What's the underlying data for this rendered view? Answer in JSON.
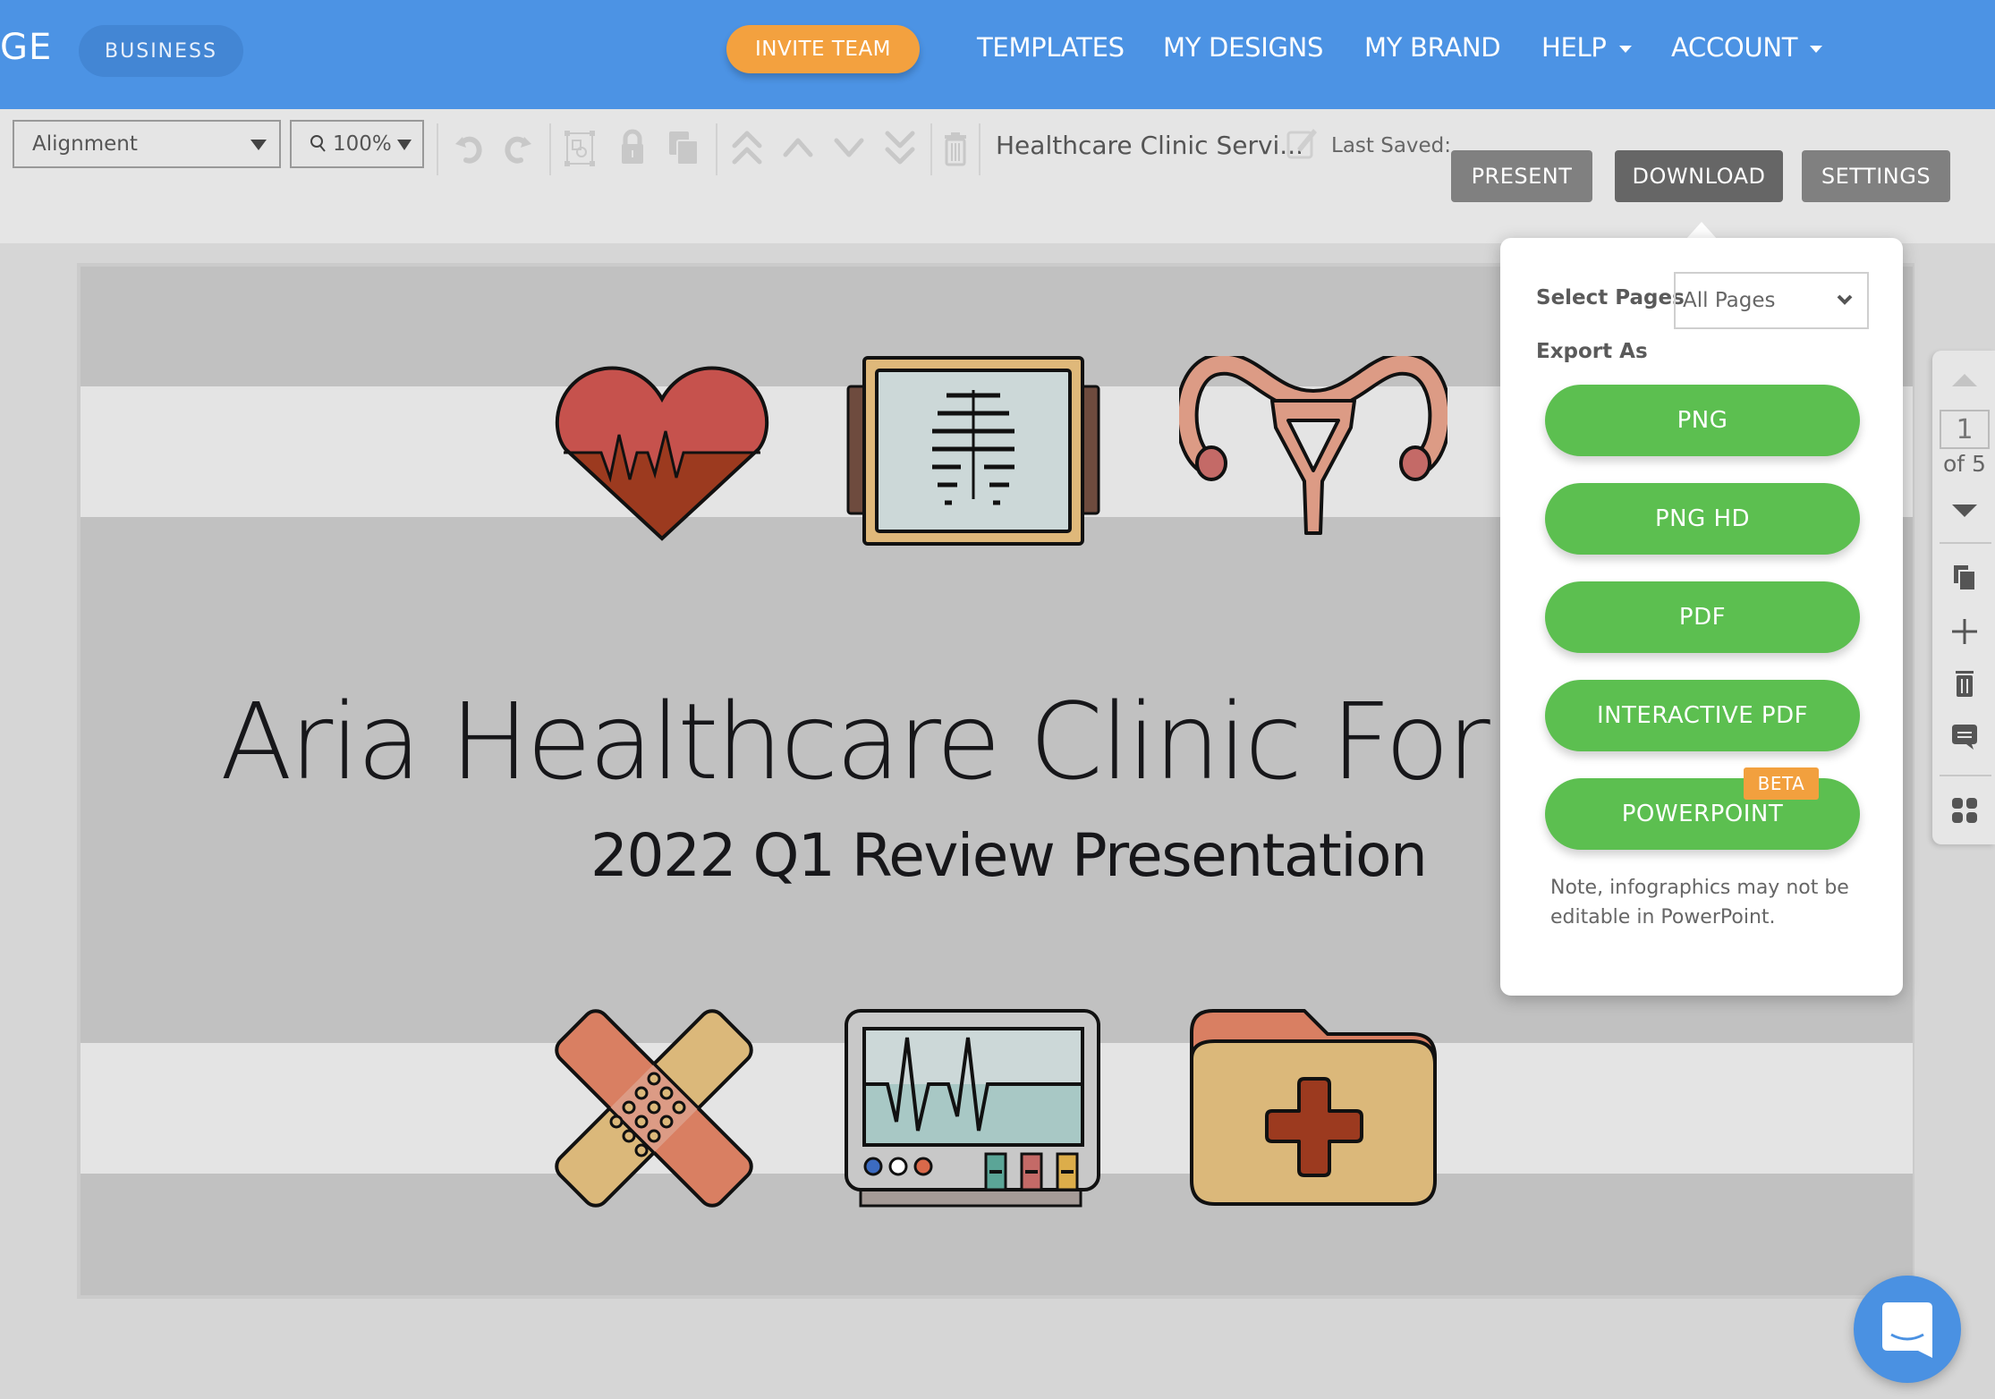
{
  "header": {
    "brand_fragment": "GE",
    "plan_badge": "BUSINESS",
    "invite_button": "INVITE TEAM",
    "nav": [
      {
        "label": "TEMPLATES",
        "has_dropdown": false
      },
      {
        "label": "MY DESIGNS",
        "has_dropdown": false
      },
      {
        "label": "MY BRAND",
        "has_dropdown": false
      },
      {
        "label": "HELP",
        "has_dropdown": true
      },
      {
        "label": "ACCOUNT",
        "has_dropdown": true
      }
    ],
    "colors": {
      "header_bg": "#4c93e4",
      "invite_bg": "#f3a13f"
    }
  },
  "toolbar": {
    "alignment_select": "Alignment",
    "zoom_select": "100%",
    "icons": [
      "undo-icon",
      "redo-icon",
      "group-icon",
      "lock-icon",
      "duplicate-icon",
      "bring-to-front-icon",
      "bring-forward-icon",
      "send-backward-icon",
      "send-to-back-icon",
      "delete-icon"
    ],
    "document_title": "Healthcare Clinic Servi...",
    "last_saved_label": "Last Saved:",
    "present_button": "PRESENT",
    "download_button": "DOWNLOAD",
    "settings_button": "SETTINGS"
  },
  "slide": {
    "title": "Aria Healthcare Clinic For W",
    "subtitle": "2022 Q1 Review Presentation",
    "top_icons": [
      "heart-pulse-icon",
      "x-ray-icon",
      "uterus-icon"
    ],
    "bottom_icons": [
      "bandage-icon",
      "heart-monitor-icon",
      "medical-folder-icon"
    ]
  },
  "download_popup": {
    "select_pages_label": "Select Pages",
    "select_pages_value": "All Pages",
    "export_as_label": "Export As",
    "export_options": [
      {
        "label": "PNG"
      },
      {
        "label": "PNG HD"
      },
      {
        "label": "PDF"
      },
      {
        "label": "INTERACTIVE PDF"
      },
      {
        "label": "POWERPOINT",
        "badge": "BETA"
      }
    ],
    "note": "Note, infographics may not be editable in PowerPoint.",
    "colors": {
      "button_bg": "#5cbf50",
      "badge_bg": "#f2a03e"
    }
  },
  "page_panel": {
    "current_page": "1",
    "of_label": "of 5",
    "actions": [
      "duplicate-page-icon",
      "add-page-icon",
      "delete-page-icon",
      "comment-icon",
      "grid-view-icon"
    ]
  },
  "chat": {
    "icon": "chat-icon"
  }
}
